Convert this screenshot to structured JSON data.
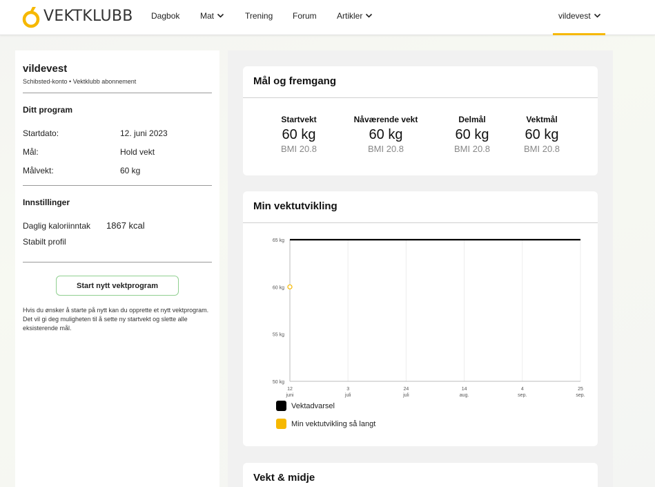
{
  "nav": {
    "logo_text": "VEKTKLUBB",
    "items": [
      {
        "label": "Dagbok",
        "dropdown": false
      },
      {
        "label": "Mat",
        "dropdown": true
      },
      {
        "label": "Trening",
        "dropdown": false
      },
      {
        "label": "Forum",
        "dropdown": false
      },
      {
        "label": "Artikler",
        "dropdown": true
      }
    ],
    "user": "vildevest"
  },
  "profile": {
    "username": "vildevest",
    "subtitle": "Schibsted-konto • Vektklubb abonnement",
    "program_title": "Ditt program",
    "start_label": "Startdato:",
    "start_value": "12. juni 2023",
    "goal_label": "Mål:",
    "goal_value": "Hold vekt",
    "target_label": "Målvekt:",
    "target_value": "60 kg",
    "settings_title": "Innstillinger",
    "calorie_label": "Daglig kaloriinntak",
    "calorie_value": "1867 kcal",
    "profile_type": "Stabilt profil",
    "new_program_button": "Start nytt vektprogram",
    "help_text": "Hvis du ønsker å starte på nytt kan du opprette et nytt vektprogram. Det vil gi deg muligheten til å sette ny startvekt og slette alle eksisterende mål."
  },
  "goals": {
    "title": "Mål og fremgang",
    "stats": [
      {
        "label": "Startvekt",
        "value": "60 kg",
        "bmi": "BMI 20.8"
      },
      {
        "label": "Nåværende vekt",
        "value": "60 kg",
        "bmi": "BMI 20.8"
      },
      {
        "label": "Delmål",
        "value": "60 kg",
        "bmi": "BMI 20.8"
      },
      {
        "label": "Vektmål",
        "value": "60 kg",
        "bmi": "BMI 20.8"
      }
    ]
  },
  "weight_chart": {
    "title": "Min vektutvikling",
    "legend": [
      "Vektadvarsel",
      "Min vektutvikling så langt"
    ]
  },
  "waist": {
    "title": "Vekt & midje"
  },
  "colors": {
    "accent": "#f6b800",
    "warning_line": "#000000",
    "progress": "#f6b800",
    "button_border": "#8fcf8f"
  },
  "chart_data": {
    "type": "line",
    "title": "Min vektutvikling",
    "ylim": [
      50,
      65
    ],
    "y_ticks": [
      {
        "value": 65,
        "label": "65 kg"
      },
      {
        "value": 60,
        "label": "60 kg"
      },
      {
        "value": 55,
        "label": "55 kg"
      },
      {
        "value": 50,
        "label": "50 kg"
      }
    ],
    "x_ticks": [
      {
        "day": "12",
        "month": "juni"
      },
      {
        "day": "3",
        "month": "juli"
      },
      {
        "day": "24",
        "month": "juli"
      },
      {
        "day": "14",
        "month": "aug."
      },
      {
        "day": "4",
        "month": "sep."
      },
      {
        "day": "25",
        "month": "sep."
      }
    ],
    "series": [
      {
        "name": "Vektadvarsel",
        "x": [
          "12 juni",
          "25 sep."
        ],
        "y": [
          65,
          65
        ]
      },
      {
        "name": "Min vektutvikling så langt",
        "x": [
          "12 juni"
        ],
        "y": [
          60
        ]
      }
    ],
    "grid": true
  }
}
